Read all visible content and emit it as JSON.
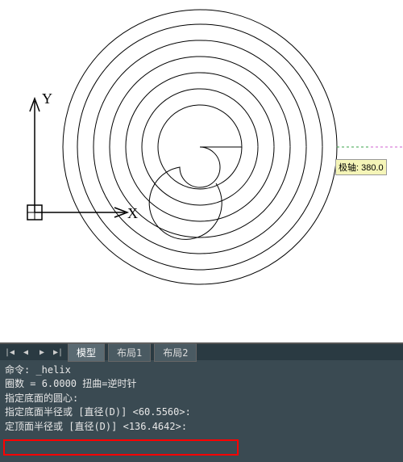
{
  "drawing": {
    "y_label": "Y",
    "x_label": "X",
    "tracking_tooltip": "极轴: 380.0"
  },
  "tabs": {
    "nav_first": "|◀",
    "nav_prev": "◀",
    "nav_next": "▶",
    "nav_last": "▶|",
    "model": "模型",
    "layout1": "布局1",
    "layout2": "布局2"
  },
  "command": {
    "line1_prefix": "命令: ",
    "line1_cmd": "_helix",
    "line2_prefix": "圈数 = ",
    "line2_turns": "6.0000",
    "line2_twistlabel": "    扭曲=",
    "line2_twist": "逆时针",
    "line3": "指定底面的圆心:",
    "line4_prefix": "指定底面半径或 [直径(D)] <",
    "line4_val": "60.5560",
    "line4_suffix": ">:",
    "line5_prefix": "定顶面半径或 [直径(D)] <",
    "line5_val": "136.4642",
    "line5_suffix": ">:"
  },
  "chart_data": {
    "type": "other",
    "description": "CAD helix/spiral top view",
    "center": [
      248,
      182
    ],
    "base_radius": 60.556,
    "top_radius": 136.4642,
    "turns": 6.0,
    "twist": "CCW",
    "tracking_distance": 380.0,
    "ucs_axes": [
      "X",
      "Y"
    ]
  }
}
